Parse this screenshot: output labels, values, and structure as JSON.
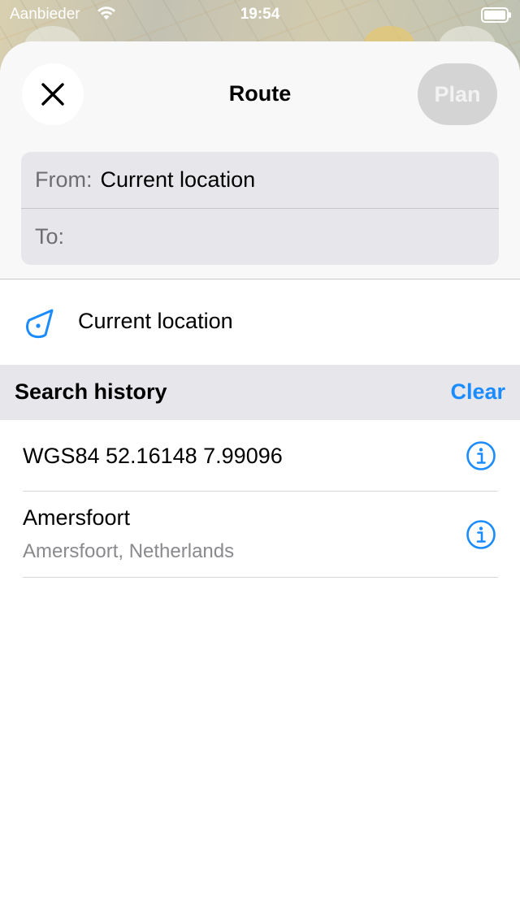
{
  "status_bar": {
    "carrier": "Aanbieder",
    "time": "19:54"
  },
  "header": {
    "title": "Route",
    "plan_label": "Plan"
  },
  "route": {
    "from_label": "From:",
    "from_value": "Current location",
    "to_label": "To:",
    "to_value": ""
  },
  "current_location": {
    "label": "Current location"
  },
  "search_history": {
    "title": "Search history",
    "clear_label": "Clear",
    "items": [
      {
        "title": "WGS84 52.16148 7.99096"
      },
      {
        "title": "Amersfoort",
        "subtitle": "Amersfoort, Netherlands"
      }
    ]
  },
  "colors": {
    "accent": "#1a8cff",
    "section_background": "#e6e6eb",
    "disabled_button": "#d4d4d4"
  },
  "icons": {
    "close": "close-icon",
    "location": "location-arrow-icon",
    "info": "info-icon",
    "wifi": "wifi-icon",
    "battery": "battery-icon"
  }
}
